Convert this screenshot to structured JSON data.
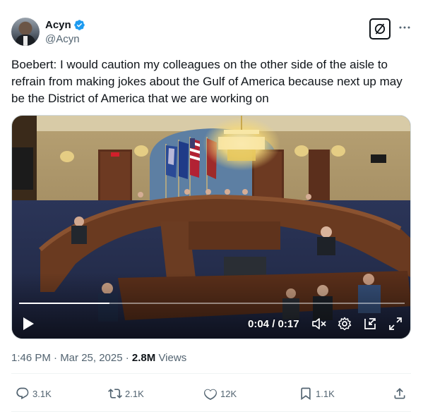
{
  "author": {
    "display_name": "Acyn",
    "handle": "@Acyn",
    "verified": true,
    "verified_color": "#1d9bf0"
  },
  "tweet": {
    "text": "Boebert: I would caution my colleagues on the other side of the aisle to refrain from making jokes about the Gulf of America because next up may be the District of America that we are working on"
  },
  "video": {
    "time_display": "0:04 / 0:17",
    "progress_fraction": 0.2353,
    "controls": [
      "play-icon",
      "mute-icon",
      "settings-icon",
      "pip-icon",
      "fullscreen-icon"
    ]
  },
  "meta": {
    "timestamp": "1:46 PM · Mar 25, 2025 · ",
    "views_count": "2.8M",
    "views_label": " Views"
  },
  "actions": {
    "replies": "3.1K",
    "reposts": "2.1K",
    "likes": "12K",
    "bookmarks": "1.1K"
  },
  "icons": {
    "grok": "grok-icon",
    "more": "more-icon",
    "reply": "reply-icon",
    "repost": "repost-icon",
    "like": "heart-icon",
    "bookmark": "bookmark-icon",
    "share": "share-icon"
  },
  "colors": {
    "text_primary": "#0f1419",
    "text_secondary": "#536471",
    "accent": "#1d9bf0",
    "border": "#cfd9de"
  }
}
